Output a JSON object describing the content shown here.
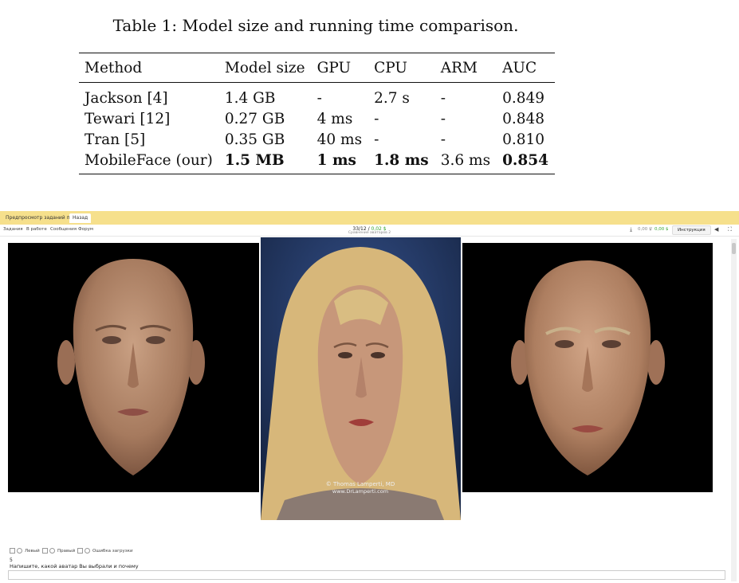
{
  "paper": {
    "caption": "Table 1: Model size and running time comparison.",
    "headers": [
      "Method",
      "Model size",
      "GPU",
      "CPU",
      "ARM",
      "AUC"
    ],
    "rows": [
      [
        "Jackson [4]",
        "1.4 GB",
        "-",
        "2.7 s",
        "-",
        "0.849"
      ],
      [
        "Tewari [12]",
        "0.27 GB",
        "4 ms",
        "-",
        "-",
        "0.848"
      ],
      [
        "Tran [5]",
        "0.35 GB",
        "40 ms",
        "-",
        "-",
        "0.810"
      ],
      [
        "MobileFace (our)",
        "1.5 MB",
        "1 ms",
        "1.8 ms",
        "3.6 ms",
        "0.854"
      ]
    ],
    "bold_cells_in_last_row": [
      "Model size",
      "GPU",
      "CPU",
      "AUC"
    ]
  },
  "ui": {
    "tabs": [
      "Предпросмотр заданий пула",
      "Назад"
    ],
    "nav": [
      "Задания",
      "В работе",
      "Сообщения",
      "Форум"
    ],
    "counter": "33/12",
    "reward": "0,02 $",
    "subtitle": "Сравнение аватаров 2",
    "balance_1": "0,00 $",
    "balance_2": "0,00 $",
    "instructions_button": "Инструкция",
    "watermark_1": "© Thomas Lamperti, MD",
    "watermark_2": "www.DrLamperti.com",
    "options": [
      "Левый",
      "Правый",
      "Ошибка загрузки"
    ],
    "answer_value": "5",
    "question": "Напишите, какой аватар Вы выбрали и почему",
    "colors": {
      "top_bar": "#f6e08c",
      "reward_green": "#3aa534",
      "photo_background": "#243864",
      "render_background": "#000000"
    }
  }
}
